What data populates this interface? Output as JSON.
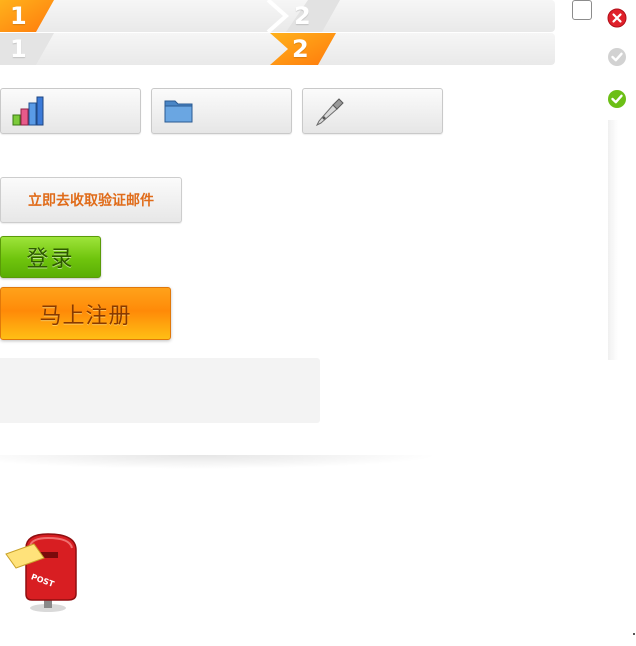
{
  "steps": {
    "bar1": {
      "step1": "1",
      "step2": "2",
      "active": 1
    },
    "bar2": {
      "step1": "1",
      "step2": "2",
      "active": 2
    }
  },
  "tool_buttons": [
    {
      "icon": "bar-chart-icon"
    },
    {
      "icon": "folder-icon"
    },
    {
      "icon": "pen-icon"
    }
  ],
  "verify_button_label": "立即去收取验证邮件",
  "login_button_label": "登录",
  "register_button_label": "马上注册",
  "status_icons": [
    "error-icon",
    "check-grey-icon",
    "check-green-icon"
  ],
  "colors": {
    "orange": "#ff8a08",
    "green": "#6fc40d",
    "error_red": "#e0202a",
    "check_green": "#6cbf16"
  }
}
